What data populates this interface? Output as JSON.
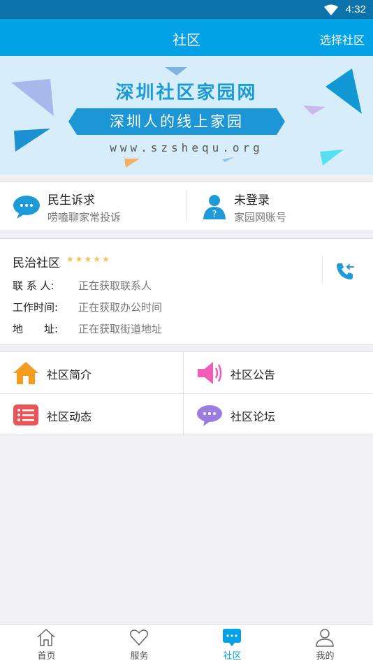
{
  "status_bar": {
    "time": "4:32"
  },
  "app_bar": {
    "title": "社区",
    "action": "选择社区"
  },
  "banner": {
    "title": "深圳社区家园网",
    "slogan": "深圳人的线上家园",
    "url": "www.szshequ.org"
  },
  "quick": {
    "complaint": {
      "title": "民生诉求",
      "subtitle": "唠嗑聊家常投诉"
    },
    "account": {
      "title": "未登录",
      "subtitle": "家园网账号"
    }
  },
  "community": {
    "name": "民治社区",
    "rating": 5,
    "stars": "★★★★★",
    "rows": [
      {
        "label": "联 系 人:",
        "value": "正在获取联系人"
      },
      {
        "label": "工作时间:",
        "value": "正在获取办公时间"
      },
      {
        "label": "地　　址:",
        "value": "正在获取街道地址"
      }
    ]
  },
  "menu": [
    {
      "label": "社区简介",
      "icon": "house-icon"
    },
    {
      "label": "社区公告",
      "icon": "speaker-icon"
    },
    {
      "label": "社区动态",
      "icon": "list-icon"
    },
    {
      "label": "社区论坛",
      "icon": "chat-bubble-icon"
    }
  ],
  "tabs": [
    {
      "label": "首页",
      "icon": "home-icon"
    },
    {
      "label": "服务",
      "icon": "heart-icon"
    },
    {
      "label": "社区",
      "icon": "community-chat-icon",
      "active": true
    },
    {
      "label": "我的",
      "icon": "user-icon"
    }
  ],
  "colors": {
    "primary": "#03a1e6",
    "status_bar": "#0c73aa",
    "star": "#f7c35a"
  }
}
